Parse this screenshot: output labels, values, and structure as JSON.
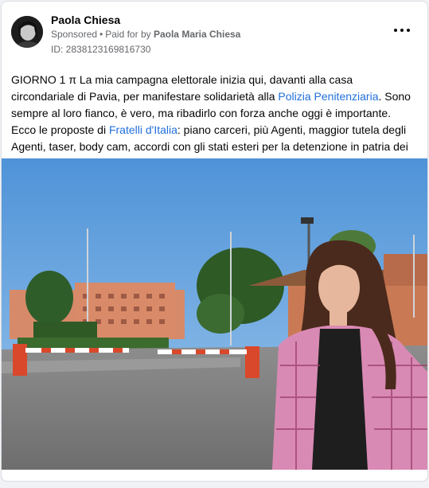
{
  "post": {
    "author_name": "Paola Chiesa",
    "sponsored_label": "Sponsored",
    "separator": "•",
    "paid_for_prefix": "Paid for by",
    "paid_for_name": "Paola Maria Chiesa",
    "ad_id": "ID: 2838123169816730",
    "more_icon": "more-horizontal-icon",
    "text": {
      "part1": "GIORNO 1 π La mia campagna elettorale inizia qui, davanti alla casa circondariale di Pavia, per manifestare solidarietà alla ",
      "link1": "Polizia Penitenziaria",
      "part2": ". Sono sempre al loro fianco, è vero, ma ribadirlo con forza anche oggi è importante. Ecco le proposte di ",
      "link2": "Fratelli d'Italia",
      "part3": ": piano carceri, più Agenti, maggior tutela degli Agenti, taser, body cam, accordi con gli stati esteri per la detenzione in patria dei detenuti stranieri."
    }
  },
  "colors": {
    "link": "#216fdb",
    "text": "#050505",
    "muted": "#65676b",
    "sky": "#6aa6e0",
    "barrier_red": "#d9482b"
  }
}
